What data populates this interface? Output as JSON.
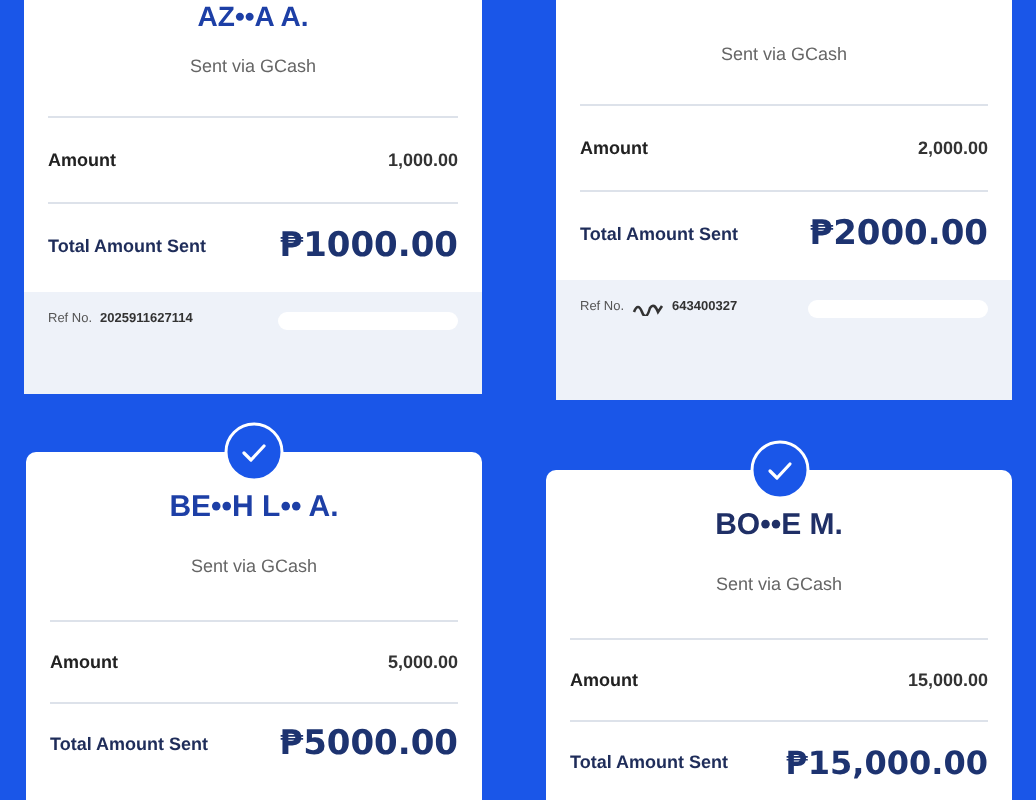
{
  "receipts": [
    {
      "check_mark": false,
      "recipient": "AZ••A A.",
      "via": "Sent via GCash",
      "amount_label": "Amount",
      "amount": "1,000.00",
      "total_label": "Total Amount Sent",
      "total": "₱1000.00",
      "ref_label": "Ref No.",
      "ref_number": "2025911627114",
      "ref_scribble": false
    },
    {
      "check_mark": false,
      "via": "Sent via GCash",
      "amount_label": "Amount",
      "amount": "2,000.00",
      "total_label": "Total Amount Sent",
      "total": "₱2000.00",
      "ref_label": "Ref No.",
      "ref_number": "643400327",
      "ref_scribble": true
    },
    {
      "check_mark": true,
      "recipient": "BE••H L•• A.",
      "via": "Sent via GCash",
      "amount_label": "Amount",
      "amount": "5,000.00",
      "total_label": "Total Amount Sent",
      "total": "₱5000.00"
    },
    {
      "check_mark": true,
      "recipient": "BO••E M.",
      "via": "Sent via GCash",
      "amount_label": "Amount",
      "amount": "15,000.00",
      "total_label": "Total Amount Sent",
      "total": "₱15,000.00"
    }
  ]
}
